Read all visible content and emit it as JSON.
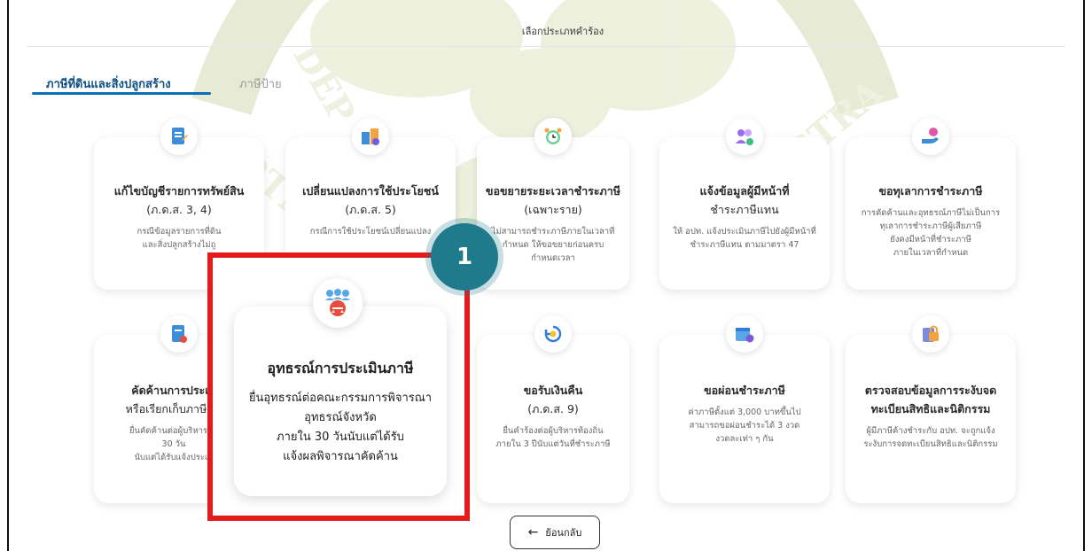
{
  "header": {
    "title": "เลือกประเภทคำร้อง"
  },
  "tabs": [
    {
      "label": "ภาษีที่ดินและสิ่งปลูกสร้าง",
      "active": true
    },
    {
      "label": "ภาษีป้าย",
      "active": false
    }
  ],
  "cards": [
    {
      "icon": "document-edit-icon",
      "title": "แก้ไขบัญชีรายการทรัพย์สิน",
      "sub": "(ภ.ด.ส. 3, 4)",
      "desc": [
        "กรณีข้อมูลรายการที่ดิน",
        "และสิ่งปลูกสร้างไม่ถู"
      ]
    },
    {
      "icon": "building-change-icon",
      "title": "เปลี่ยนแปลงการใช้ประโยชน์",
      "sub": "(ภ.ด.ส. 5)",
      "desc": [
        "กรณีการใช้ประโยชน์เปลี่ยนแปลง"
      ]
    },
    {
      "icon": "alarm-clock-icon",
      "title": "ขอขยายระยะเวลาชำระภาษี",
      "sub": "(เฉพาะราย)",
      "desc": [
        "ไม่สามารถชำระภาษีภายในเวลาที่",
        "กำหนด ให้ขอขยายก่อนครบ",
        "กำหนดเวลา"
      ]
    },
    {
      "icon": "people-icon",
      "title": "แจ้งข้อมูลผู้มีหน้าที่",
      "sub": "ชำระภาษีแทน",
      "desc": [
        "ให้ อปท. แจ้งประเมินภาษีไปยังผู้มีหน้าที่",
        "ชำระภาษีแทน ตามมาตรา 47"
      ]
    },
    {
      "icon": "hand-coin-icon",
      "title": "ขอทุเลาการชำระภาษี",
      "sub": "",
      "desc": [
        "การคัดค้านและอุทธรณ์ภาษีไม่เป็นการ",
        "ทุเลาการชำระภาษีผู้เสียภาษี",
        "ยังคงมีหน้าที่ชำระภาษี",
        "ภายในเวลาที่กำหนด"
      ]
    },
    {
      "icon": "document-objection-icon",
      "title": "คัดค้านการประเมิ",
      "sub": "หรือเรียกเก็บภาษี (ภ",
      "desc": [
        "ยื่นคัดค้านต่อผู้บริหารท้อ",
        "30 วัน",
        "นับแต่ได้รับแจ้งประเมิ"
      ]
    },
    {
      "icon": "refund-icon",
      "title": "ขอรับเงินคืน",
      "sub": "(ภ.ด.ส. 9)",
      "desc": [
        "ยื่นคำร้องต่อผู้บริหารท้องถิ่น",
        "ภายใน 3 ปีนับแต่วันที่ชำระภาษี"
      ]
    },
    {
      "icon": "calendar-pay-icon",
      "title": "ขอผ่อนชำระภาษี",
      "sub": "",
      "desc": [
        "ค่าภาษีตั้งแต่ 3,000 บาทขึ้นไป",
        "สามารถขอผ่อนชำระได้ 3 งวด",
        "งวดละเท่า ๆ กัน"
      ]
    },
    {
      "icon": "lock-document-icon",
      "title": "ตรวจสอบข้อมูลการระงับจด",
      "sub": "ทะเบียนสิทธิและนิติกรรม",
      "desc": [
        "ผู้มีภาษีค้างชำระกับ อปท. จะถูกแจ้ง",
        "ระงับการจดทะเบียนสิทธิและนิติกรรม"
      ]
    }
  ],
  "highlight": {
    "icon": "appeal-people-icon",
    "title": "อุทธรณ์การประเมินภาษี",
    "desc": [
      "ยื่นอุทธรณ์ต่อคณะกรรมการพิจารณา",
      "อุทธรณ์จังหวัด",
      "ภายใน 30 วันนับแต่ได้รับ",
      "แจ้งผลพิจารณาคัดค้าน"
    ],
    "step": "1",
    "border_color": "#e31b1b"
  },
  "back_button": {
    "icon": "arrow-left-icon",
    "label": "ย้อนกลับ"
  },
  "colors": {
    "accent": "#0d4f86",
    "step_badge": "#1f7a8c",
    "watermark": "#e9ecd6"
  }
}
